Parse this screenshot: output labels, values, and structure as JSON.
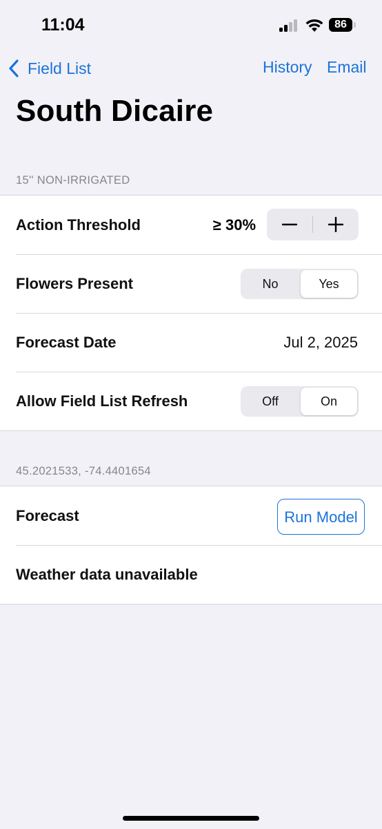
{
  "status_bar": {
    "time": "11:04",
    "battery": "86"
  },
  "nav": {
    "back_label": "Field List",
    "history_label": "History",
    "email_label": "Email"
  },
  "title": "South Dicaire",
  "section1": {
    "header": "15'' NON-IRRIGATED",
    "action_threshold": {
      "label": "Action Threshold",
      "value": "≥ 30%"
    },
    "flowers_present": {
      "label": "Flowers Present",
      "options": [
        "No",
        "Yes"
      ],
      "selected": "Yes"
    },
    "forecast_date": {
      "label": "Forecast Date",
      "value": "Jul 2, 2025"
    },
    "allow_refresh": {
      "label": "Allow Field List Refresh",
      "options": [
        "Off",
        "On"
      ],
      "selected": "On"
    }
  },
  "section2": {
    "header": "45.2021533, -74.4401654",
    "forecast": {
      "label": "Forecast",
      "button": "Run Model"
    },
    "weather": {
      "label": "Weather data unavailable"
    }
  },
  "colors": {
    "accent": "#1a73d9",
    "background": "#f2f1f7"
  }
}
